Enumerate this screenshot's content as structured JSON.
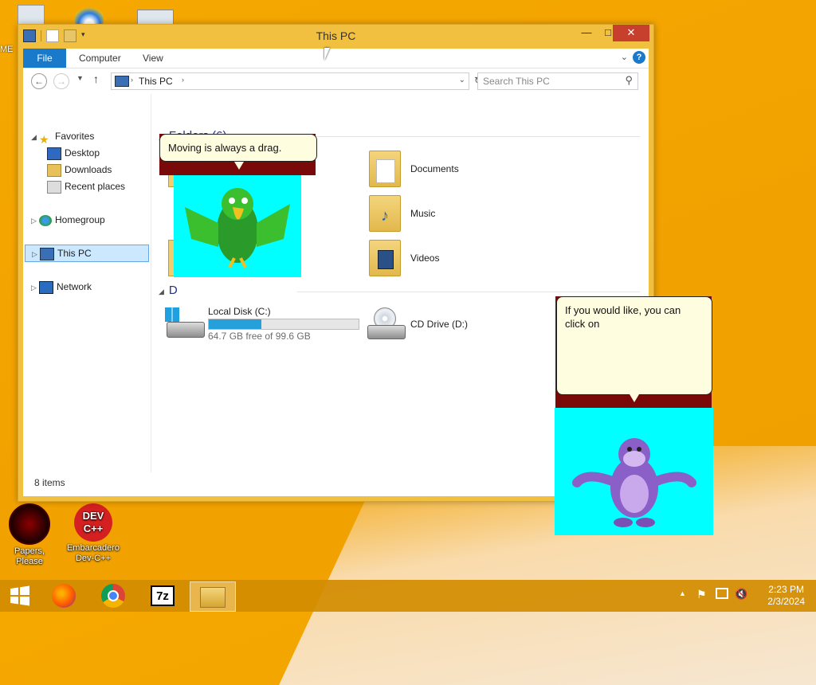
{
  "desktop": {
    "icons": [
      {
        "label": "Papers, Please"
      },
      {
        "label": "Embarcadero Dev-C++"
      }
    ]
  },
  "window": {
    "title": "This PC",
    "ribbon_tabs": [
      "File",
      "Computer",
      "View"
    ],
    "address": "This PC",
    "search_placeholder": "Search This PC",
    "nav": {
      "favorites": "Favorites",
      "desktop": "Desktop",
      "downloads": "Downloads",
      "recent": "Recent places",
      "homegroup": "Homegroup",
      "this_pc": "This PC",
      "network": "Network"
    },
    "folders_header": "Folders (6)",
    "folders": [
      "Documents",
      "Music",
      "Videos"
    ],
    "devices_header": "D",
    "drives": {
      "c_label": "Local Disk (C:)",
      "c_free": "64.7 GB free of 99.6 GB",
      "c_used_fraction": 0.35,
      "d_label": "CD Drive (D:)"
    },
    "status": "8 items"
  },
  "agents": {
    "parrot_text": "Moving is always a drag.",
    "bonzi_text": "If you would like, you can click on"
  },
  "taskbar": {
    "time": "2:23 PM",
    "date": "2/3/2024"
  }
}
